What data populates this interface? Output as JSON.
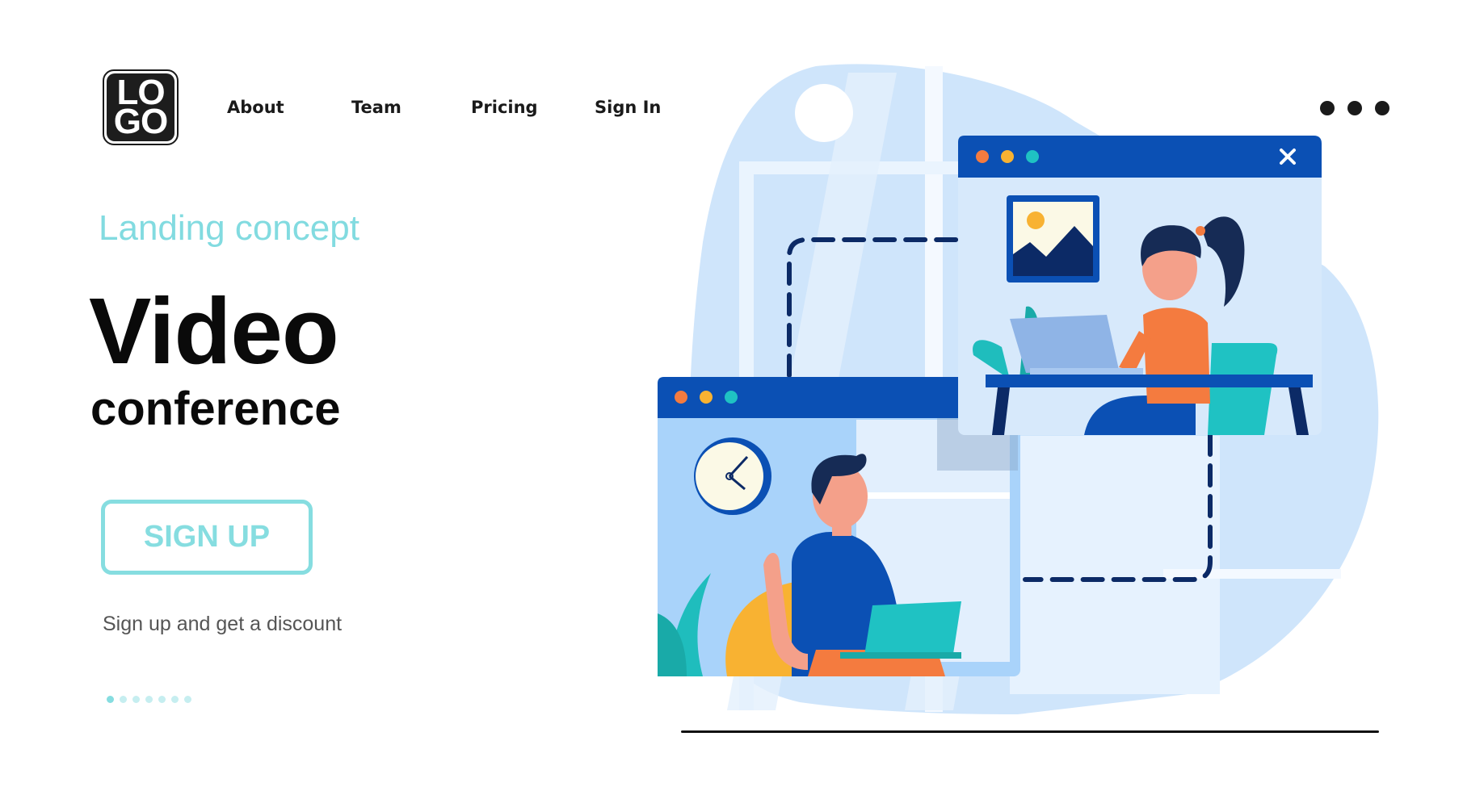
{
  "logo": {
    "line1": "LO",
    "line2": "GO"
  },
  "nav": [
    {
      "label": "About"
    },
    {
      "label": "Team"
    },
    {
      "label": "Pricing"
    },
    {
      "label": "Sign In"
    }
  ],
  "hero": {
    "subtitle": "Landing concept",
    "title": "Video",
    "title_line2": "conference",
    "cta_label": "SIGN UP",
    "cta_caption": "Sign up and get a discount"
  },
  "pagination": {
    "total": 7,
    "active": 1
  },
  "menu_icon": "more-horizontal-icon",
  "colors": {
    "accent": "#86dde0",
    "window_bar": "#0b50b4",
    "dot_red": "#f47b3f",
    "dot_yellow": "#f8b232",
    "dot_teal": "#1fc2c3"
  }
}
